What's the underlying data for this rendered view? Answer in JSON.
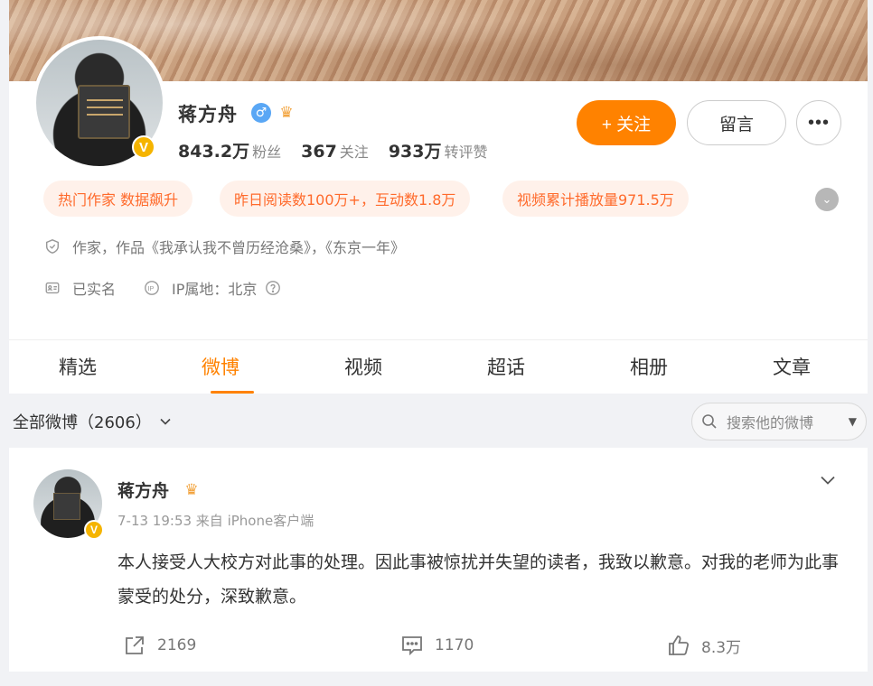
{
  "profile": {
    "name": "蒋方舟",
    "gender_icon": "♂",
    "verified_badge": "V",
    "stats": [
      {
        "num": "843.2万",
        "label": "粉丝"
      },
      {
        "num": "367",
        "label": "关注"
      },
      {
        "num": "933万",
        "label": "转评赞"
      }
    ],
    "follow_label": "+ 关注",
    "message_label": "留言",
    "more_label": "•••",
    "tags": [
      "热门作家 数据飙升",
      "昨日阅读数100万+，互动数1.8万",
      "视频累计播放量971.5万"
    ],
    "bio": "作家，作品《我承认我不曾历经沧桑》，《东京一年》",
    "real_name": "已实名",
    "ip_location": "IP属地：北京"
  },
  "tabs": [
    "精选",
    "微博",
    "视频",
    "超话",
    "相册",
    "文章"
  ],
  "active_tab": "微博",
  "filter": {
    "label": "全部微博（2606）"
  },
  "search": {
    "placeholder": "搜索他的微博"
  },
  "post": {
    "author": "蒋方舟",
    "meta": "7-13 19:53  来自 iPhone客户端",
    "text": "本人接受人大校方对此事的处理。因此事被惊扰并失望的读者，我致以歉意。对我的老师为此事蒙受的处分，深致歉意。",
    "reposts": "2169",
    "comments": "1170",
    "likes": "8.3万"
  },
  "colors": {
    "accent": "#ff8200",
    "tag_text": "#ff6a2b",
    "tag_bg": "#fff1ea",
    "badge": "#f5b400"
  }
}
